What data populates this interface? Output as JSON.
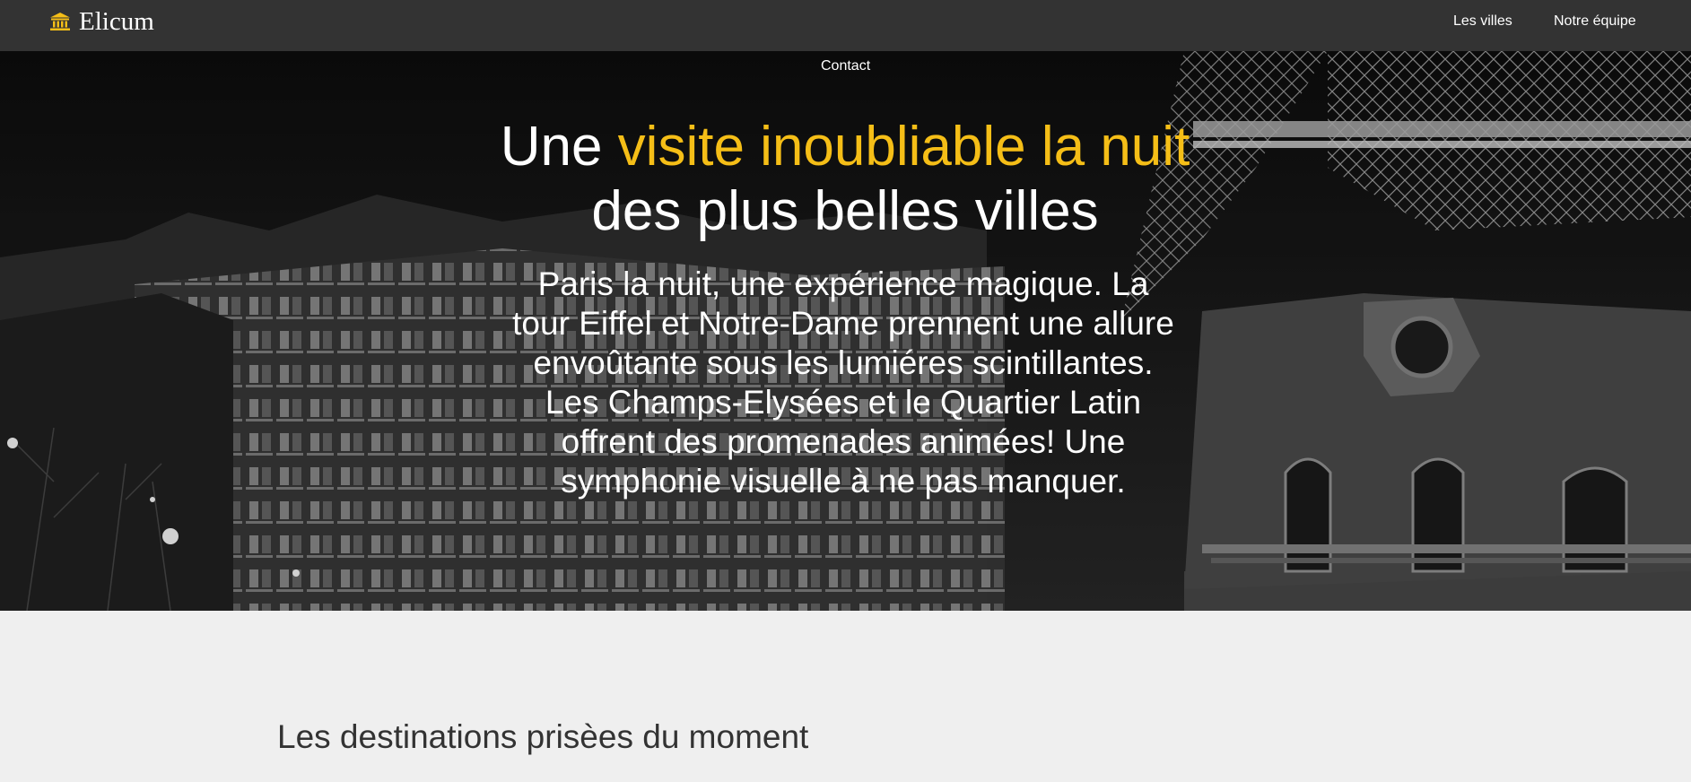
{
  "nav": {
    "brand": "Elicum",
    "brand_icon": "bank-building-icon",
    "links": [
      "Les villes",
      "Notre équipe",
      "Contact"
    ]
  },
  "hero": {
    "title_plain_1": "Une ",
    "title_accent": "visite inoubliable la nuit",
    "title_plain_2": "des plus belles villes",
    "text": "Paris la nuit, une expérience magique. La tour Eiffel et Notre-Dame prennent une allure envoûtante sous les lumiéres scintillantes. Les Champs-Elysées et le Quartier Latin offrent des promenades animées! Une symphonie visuelle à ne pas manquer.",
    "image": "paris-night-eiffel-tower-photo"
  },
  "destinations": {
    "title": "Les destinations prisèes du moment"
  },
  "colors": {
    "accent": "#f5be17",
    "navbar": "#333333",
    "page_bg": "#efefef",
    "heading": "#333333"
  }
}
